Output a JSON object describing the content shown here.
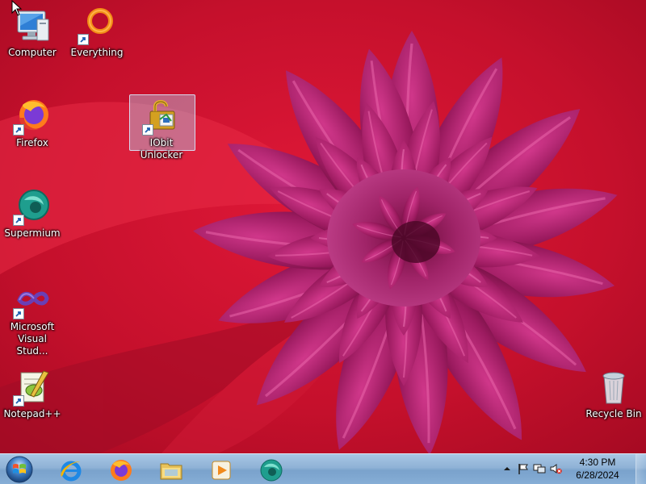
{
  "desktop": {
    "icons": [
      {
        "label": "Computer",
        "icon": "computer-icon"
      },
      {
        "label": "Everything",
        "icon": "everything-icon"
      },
      {
        "label": "Firefox",
        "icon": "firefox-icon"
      },
      {
        "label": "IObit Unlocker",
        "icon": "iobit-unlocker-icon",
        "selected": true
      },
      {
        "label": "Supermium",
        "icon": "supermium-icon"
      },
      {
        "label": "Microsoft Visual Stud...",
        "icon": "visual-studio-icon"
      },
      {
        "label": "Notepad++",
        "icon": "notepad-plus-plus-icon"
      },
      {
        "label": "Recycle Bin",
        "icon": "recycle-bin-icon"
      }
    ]
  },
  "taskbar": {
    "start": {
      "icon": "windows-start-icon"
    },
    "pinned": [
      {
        "name": "Internet Explorer",
        "icon": "internet-explorer-icon"
      },
      {
        "name": "Firefox",
        "icon": "firefox-icon"
      },
      {
        "name": "Windows Explorer",
        "icon": "folder-icon"
      },
      {
        "name": "Windows Media Player",
        "icon": "media-player-icon"
      },
      {
        "name": "Supermium",
        "icon": "supermium-icon"
      }
    ],
    "tray": {
      "icons": [
        "show-hidden-icons-icon",
        "action-center-flag-icon",
        "network-icon",
        "volume-muted-icon"
      ],
      "time": "4:30 PM",
      "date": "6/28/2024"
    }
  },
  "colors": {
    "wallpaper_red": "#c8102e",
    "petal_magenta": "#8e1458",
    "taskbar_blue": "#8fb2d6"
  }
}
